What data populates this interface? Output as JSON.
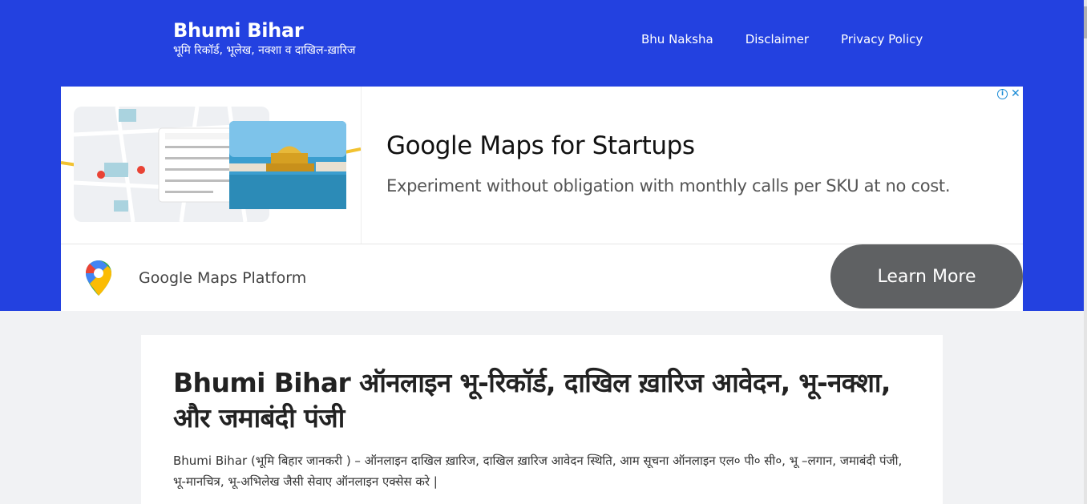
{
  "header": {
    "title": "Bhumi Bihar",
    "tagline": "भूमि रिकॉर्ड, भूलेख, नक्शा व दाखिल-ख़ारिज",
    "nav": [
      "Bhu Naksha",
      "Disclaimer",
      "Privacy Policy"
    ],
    "bg_color": "#2341e0"
  },
  "ad": {
    "headline": "Google Maps for Startups",
    "description": "Experiment without obligation with monthly calls per SKU at no cost.",
    "advertiser": "Google Maps Platform",
    "cta": "Learn More",
    "icons": [
      "adchoices-info-icon",
      "close-icon",
      "google-maps-pin-icon"
    ]
  },
  "article": {
    "title": "Bhumi Bihar ऑनलाइन भू-रिकॉर्ड, दाखिल ख़ारिज आवेदन, भू-नक्शा, और जमाबंदी पंजी",
    "intro": "Bhumi Bihar (भूमि बिहार जानकरी ) – ऑनलाइन दाखिल ख़ारिज, दाखिल ख़ारिज आवेदन स्थिति, आम सूचना ऑनलाइन एल० पी० सी०, भू –लगान, जमाबंदी पंजी, भू-मानचित्र, भू-अभिलेख जैसी सेवाए ऑनलाइन एक्सेस करे |"
  }
}
